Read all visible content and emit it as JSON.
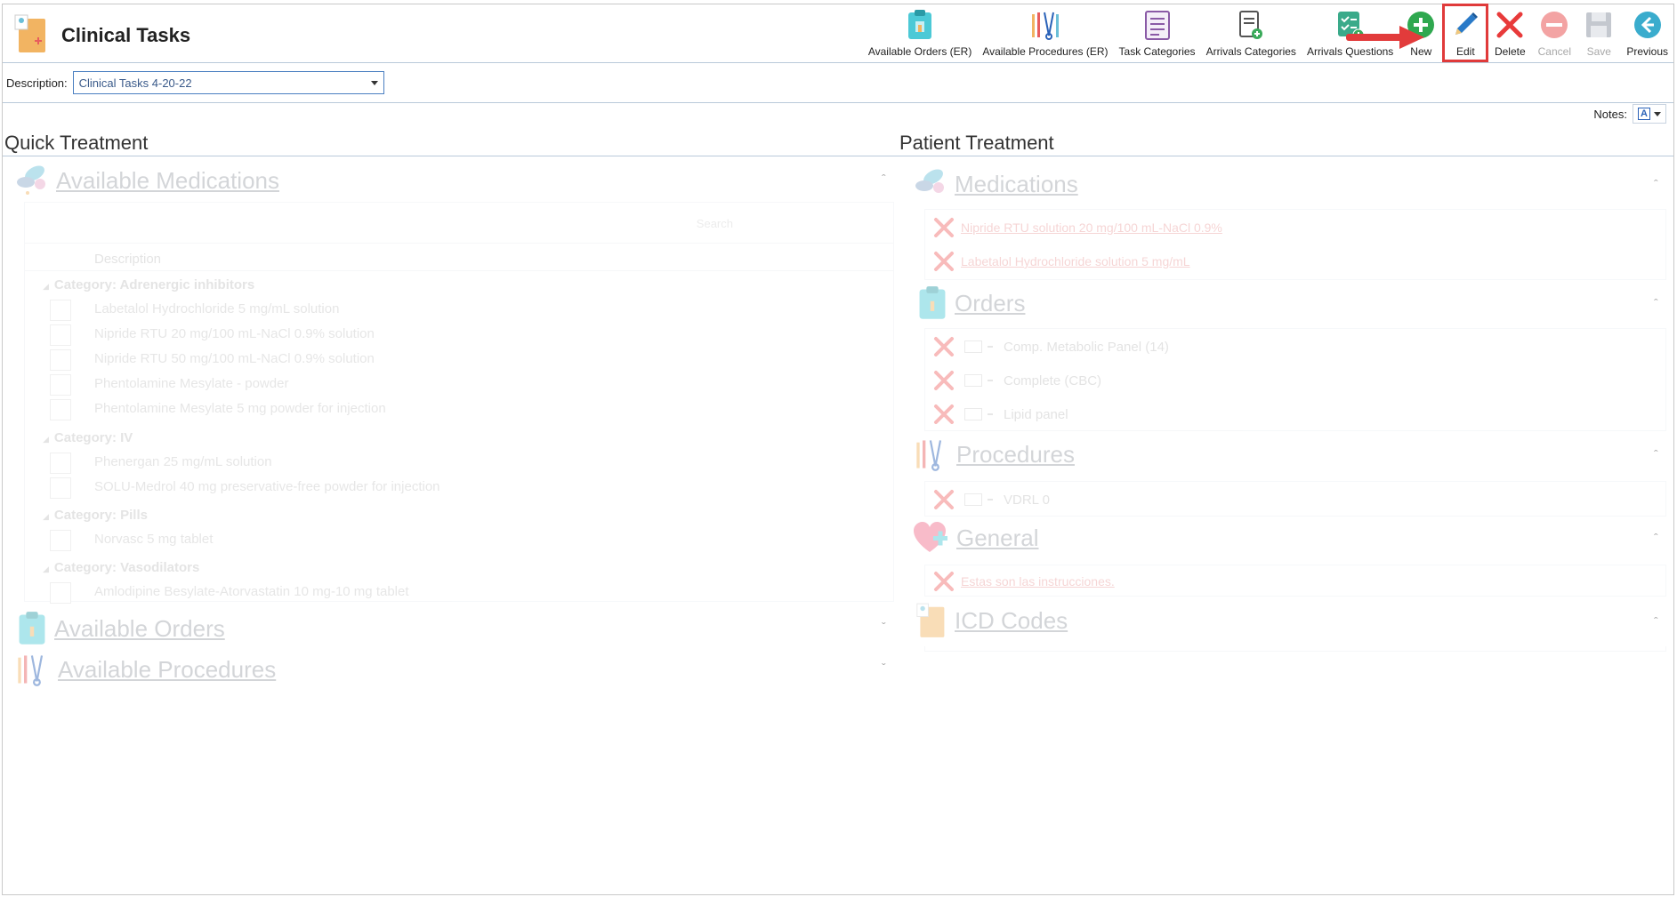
{
  "app": {
    "title": "Clinical Tasks"
  },
  "toolbar": {
    "buttons": [
      {
        "label": "Available Orders (ER)",
        "icon": "orders-clipboard-icon",
        "enabled": true
      },
      {
        "label": "Available Procedures (ER)",
        "icon": "surgical-tools-icon",
        "enabled": true
      },
      {
        "label": "Task Categories",
        "icon": "task-list-icon",
        "enabled": true
      },
      {
        "label": "Arrivals Categories",
        "icon": "clipboard-add-icon",
        "enabled": true
      },
      {
        "label": "Arrivals Questions",
        "icon": "checklist-add-icon",
        "enabled": true
      },
      {
        "label": "New",
        "icon": "plus-circle-icon",
        "enabled": true
      },
      {
        "label": "Edit",
        "icon": "pencil-icon",
        "enabled": true,
        "highlighted": true
      },
      {
        "label": "Delete",
        "icon": "red-x-icon",
        "enabled": true
      },
      {
        "label": "Cancel",
        "icon": "no-entry-icon",
        "enabled": false
      },
      {
        "label": "Save",
        "icon": "floppy-disk-icon",
        "enabled": false
      },
      {
        "label": "Previous",
        "icon": "arrow-left-circle-icon",
        "enabled": true
      }
    ]
  },
  "description": {
    "label": "Description:",
    "value": "Clinical Tasks 4-20-22"
  },
  "notes": {
    "label": "Notes:"
  },
  "quick_treatment": {
    "title": "Quick Treatment",
    "available_medications": {
      "title": "Available Medications",
      "search_placeholder": "Search",
      "column_header": "Description",
      "groups": [
        {
          "category": "Category: Adrenergic inhibitors",
          "items": [
            "Labetalol Hydrochloride 5 mg/mL solution",
            "Nipride RTU 20 mg/100 mL-NaCl 0.9% solution",
            "Nipride RTU 50 mg/100 mL-NaCl 0.9% solution",
            "Phentolamine Mesylate - powder",
            "Phentolamine Mesylate 5 mg powder for injection"
          ]
        },
        {
          "category": "Category: IV",
          "items": [
            "Phenergan 25 mg/mL solution",
            "SOLU-Medrol 40 mg preservative-free powder for injection"
          ]
        },
        {
          "category": "Category: Pills",
          "items": [
            "Norvasc 5 mg tablet"
          ]
        },
        {
          "category": "Category: Vasodilators",
          "items": [
            "Amlodipine Besylate-Atorvastatin 10 mg-10 mg tablet"
          ]
        }
      ]
    },
    "available_orders": {
      "title": "Available Orders"
    },
    "available_procedures": {
      "title": "Available Procedures"
    }
  },
  "patient_treatment": {
    "title": "Patient Treatment",
    "medications": {
      "title": "Medications",
      "items": [
        "Nipride RTU solution 20 mg/100 mL-NaCl 0.9%",
        "Labetalol Hydrochloride solution 5 mg/mL"
      ]
    },
    "orders": {
      "title": "Orders",
      "items": [
        "Comp. Metabolic Panel (14)",
        "Complete (CBC)",
        "Lipid panel"
      ]
    },
    "procedures": {
      "title": "Procedures",
      "items": [
        "VDRL 0"
      ]
    },
    "general": {
      "title": "General",
      "items": [
        "Estas son las instrucciones."
      ]
    },
    "icd_codes": {
      "title": "ICD Codes"
    }
  },
  "colors": {
    "accent": "#2a62b8",
    "highlight": "#e03a3a",
    "section_text": "#a0a4ab"
  }
}
